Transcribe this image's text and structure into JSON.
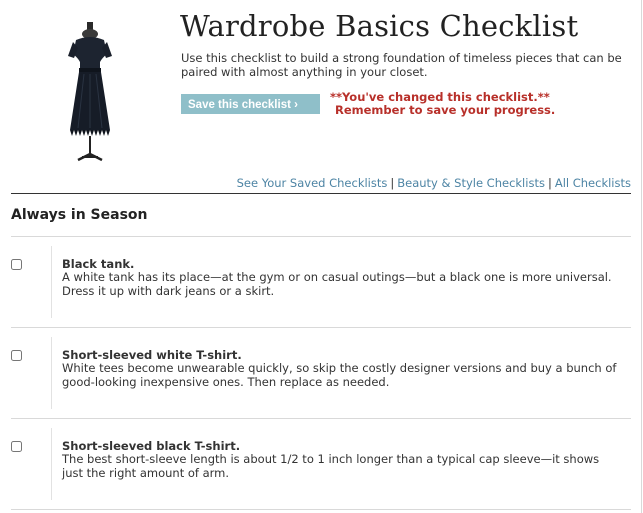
{
  "header": {
    "title": "Wardrobe Basics Checklist",
    "intro": "Use this checklist to build a strong foundation of timeless pieces that can be paired with almost anything in your closet.",
    "save_button": "Save this checklist ›",
    "changed_line1": "**You've changed this checklist.**",
    "changed_line2": "Remember to save your progress.",
    "product_image": "black-dress-on-mannequin"
  },
  "nav_links": {
    "saved": "See Your Saved Checklists",
    "beauty": "Beauty & Style Checklists",
    "all": "All Checklists",
    "separator": "|"
  },
  "section": {
    "title": "Always in Season"
  },
  "items": [
    {
      "name": "Black tank.",
      "description": "A white tank has its place—at the gym or on casual outings—but a black one is more universal. Dress it up with dark jeans or a skirt.",
      "checked": false
    },
    {
      "name": "Short-sleeved white T-shirt.",
      "description": "White tees become unwearable quickly, so skip the costly designer versions and buy a bunch of good-looking inexpensive ones. Then replace as needed.",
      "checked": false
    },
    {
      "name": "Short-sleeved black T-shirt.",
      "description": "The best short-sleeve length is about 1/2 to 1 inch longer than a typical cap sleeve—it shows just the right amount of arm.",
      "checked": false
    }
  ],
  "colors": {
    "button_bg": "#8fbfc9",
    "alert_text": "#b8302a",
    "link": "#4d84a4"
  }
}
